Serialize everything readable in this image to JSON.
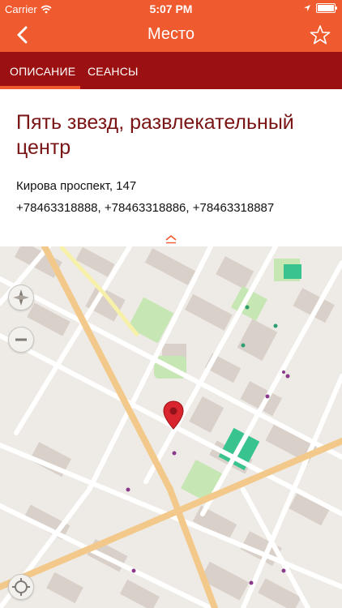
{
  "status_bar": {
    "carrier": "Carrier",
    "time": "5:07 PM"
  },
  "nav": {
    "title": "Место"
  },
  "tabs": [
    {
      "label": "ОПИСАНИЕ"
    },
    {
      "label": "СЕАНСЫ"
    }
  ],
  "place": {
    "name": "Пять звезд, развлекательный центр",
    "address": "Кирова проспект, 147",
    "phones": "+78463318888, +78463318886, +78463318887"
  },
  "colors": {
    "bar": "#ef5a2e",
    "tabs": "#9b1112",
    "title_text": "#7a1414",
    "map_bg": "#eeebe6",
    "map_pin": "#d9252e"
  },
  "icons": [
    "back-arrow-icon",
    "favorite-star-icon",
    "wifi-icon",
    "location-arrow-icon",
    "battery-icon",
    "collapse-chevron-icon",
    "compass-icon",
    "zoom-out-icon",
    "locate-me-icon",
    "map-pin-icon"
  ]
}
